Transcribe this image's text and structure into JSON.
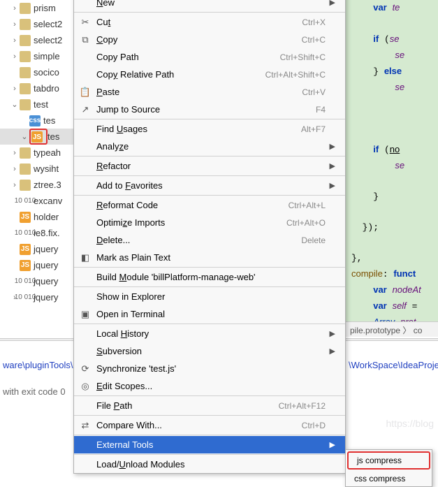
{
  "tree": {
    "items": [
      {
        "chev": "›",
        "indent": 1,
        "icon": "folder",
        "label": "prism"
      },
      {
        "chev": "›",
        "indent": 1,
        "icon": "folder",
        "label": "select2"
      },
      {
        "chev": "›",
        "indent": 1,
        "icon": "folder",
        "label": "select2"
      },
      {
        "chev": "›",
        "indent": 1,
        "icon": "folder",
        "label": "simple"
      },
      {
        "chev": "",
        "indent": 1,
        "icon": "folder",
        "label": "socico"
      },
      {
        "chev": "›",
        "indent": 1,
        "icon": "folder",
        "label": "tabdro"
      },
      {
        "chev": "⌄",
        "indent": 1,
        "icon": "folder",
        "label": "test"
      },
      {
        "chev": "",
        "indent": 2,
        "icon": "css",
        "label": "tes"
      },
      {
        "chev": "⌄",
        "indent": 2,
        "icon": "js",
        "label": "tes",
        "selected": true,
        "boxed": true
      },
      {
        "chev": "›",
        "indent": 1,
        "icon": "folder",
        "label": "typeah"
      },
      {
        "chev": "›",
        "indent": 1,
        "icon": "folder",
        "label": "wysiht"
      },
      {
        "chev": "›",
        "indent": 1,
        "icon": "folder",
        "label": "ztree.3"
      },
      {
        "chev": "",
        "indent": 1,
        "icon": "bin",
        "label": "excanv"
      },
      {
        "chev": "",
        "indent": 1,
        "icon": "js",
        "label": "holder"
      },
      {
        "chev": "",
        "indent": 1,
        "icon": "bin",
        "label": "ie8.fix."
      },
      {
        "chev": "",
        "indent": 1,
        "icon": "js",
        "label": "jquery"
      },
      {
        "chev": "",
        "indent": 1,
        "icon": "js",
        "label": "jquery"
      },
      {
        "chev": "",
        "indent": 1,
        "icon": "bin",
        "label": "jquery"
      },
      {
        "chev": "›",
        "indent": 1,
        "icon": "bin",
        "label": "jquery"
      }
    ]
  },
  "menu": [
    {
      "icon": "",
      "label": "New",
      "u": "N",
      "shortcut": "",
      "arrow": true
    },
    {
      "sep": true
    },
    {
      "icon": "✂",
      "label": "Cut",
      "u": "t",
      "shortcut": "Ctrl+X"
    },
    {
      "icon": "⧉",
      "label": "Copy",
      "u": "C",
      "shortcut": "Ctrl+C"
    },
    {
      "icon": "",
      "label": "Copy Path",
      "u": "",
      "shortcut": "Ctrl+Shift+C"
    },
    {
      "icon": "",
      "label": "Copy Relative Path",
      "u": "y",
      "shortcut": "Ctrl+Alt+Shift+C"
    },
    {
      "icon": "📋",
      "label": "Paste",
      "u": "P",
      "shortcut": "Ctrl+V"
    },
    {
      "icon": "↗",
      "label": "Jump to Source",
      "u": "",
      "shortcut": "F4"
    },
    {
      "sep": true
    },
    {
      "icon": "",
      "label": "Find Usages",
      "u": "U",
      "shortcut": "Alt+F7"
    },
    {
      "icon": "",
      "label": "Analyze",
      "u": "z",
      "shortcut": "",
      "arrow": true
    },
    {
      "sep": true
    },
    {
      "icon": "",
      "label": "Refactor",
      "u": "R",
      "shortcut": "",
      "arrow": true
    },
    {
      "sep": true
    },
    {
      "icon": "",
      "label": "Add to Favorites",
      "u": "F",
      "shortcut": "",
      "arrow": true
    },
    {
      "sep": true
    },
    {
      "icon": "",
      "label": "Reformat Code",
      "u": "R",
      "shortcut": "Ctrl+Alt+L"
    },
    {
      "icon": "",
      "label": "Optimize Imports",
      "u": "z",
      "shortcut": "Ctrl+Alt+O"
    },
    {
      "icon": "",
      "label": "Delete...",
      "u": "D",
      "shortcut": "Delete"
    },
    {
      "icon": "◧",
      "label": "Mark as Plain Text",
      "u": "",
      "shortcut": ""
    },
    {
      "sep": true
    },
    {
      "icon": "",
      "label": "Build Module 'billPlatform-manage-web'",
      "u": "M",
      "shortcut": ""
    },
    {
      "sep": true
    },
    {
      "icon": "",
      "label": "Show in Explorer",
      "u": "",
      "shortcut": ""
    },
    {
      "icon": "▣",
      "label": "Open in Terminal",
      "u": "",
      "shortcut": ""
    },
    {
      "sep": true
    },
    {
      "icon": "",
      "label": "Local History",
      "u": "H",
      "shortcut": "",
      "arrow": true
    },
    {
      "icon": "",
      "label": "Subversion",
      "u": "S",
      "shortcut": "",
      "arrow": true
    },
    {
      "icon": "⟳",
      "label": "Synchronize 'test.js'",
      "u": "",
      "shortcut": ""
    },
    {
      "icon": "◎",
      "label": "Edit Scopes...",
      "u": "E",
      "shortcut": ""
    },
    {
      "sep": true
    },
    {
      "icon": "",
      "label": "File Path",
      "u": "P",
      "shortcut": "Ctrl+Alt+F12"
    },
    {
      "sep": true
    },
    {
      "icon": "⇄",
      "label": "Compare With...",
      "u": "",
      "shortcut": "Ctrl+D"
    },
    {
      "sep": true
    },
    {
      "icon": "",
      "label": "External Tools",
      "u": "",
      "shortcut": "",
      "arrow": true,
      "selected": true
    },
    {
      "sep": true
    },
    {
      "icon": "",
      "label": "Load/Unload Modules",
      "u": "U",
      "shortcut": ""
    }
  ],
  "submenu": {
    "items": [
      {
        "label": "js compress",
        "boxed": true
      },
      {
        "label": "css compress"
      }
    ]
  },
  "code": {
    "lines": [
      "    var te",
      "",
      "    if (se",
      "        se",
      "    } else",
      "        se",
      "",
      "",
      "",
      "    if (no",
      "        se",
      "",
      "    }",
      "",
      "  });",
      "",
      "},",
      "compile: funct",
      "    var nodeAt",
      "    var self =",
      "    Array.prot"
    ],
    "breadcrumb": "pile.prototype 〉 co"
  },
  "console": {
    "left_line1": "ware\\pluginTools\\",
    "left_line2": "with exit code 0",
    "right_line1": "\\WorkSpace\\IdeaProjec"
  },
  "watermark": "https://blog"
}
